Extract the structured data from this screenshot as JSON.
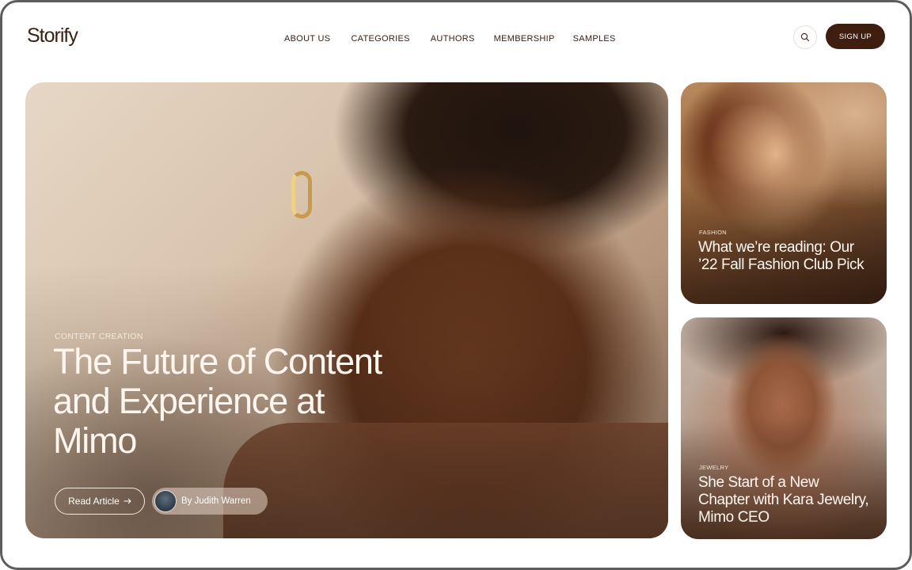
{
  "header": {
    "logo": "Storify",
    "nav": [
      "ABOUT US",
      "CATEGORIES",
      "AUTHORS",
      "MEMBERSHIP",
      "SAMPLES"
    ],
    "search_icon": "search-icon",
    "signup_label": "SIGN UP"
  },
  "hero": {
    "category": "CONTENT CREATION",
    "title": "The Future of Content and Experience at Mimo",
    "read_label": "Read Article",
    "read_icon": "arrow-right-icon",
    "author": "By Judith Warren"
  },
  "side_cards": [
    {
      "category": "FASHION",
      "title": "What we’re reading: Our ’22 Fall Fashion Club Pick"
    },
    {
      "category": "JEWELRY",
      "title": "She Start of a New Chapter with Kara Jewelry, Mimo CEO"
    }
  ],
  "colors": {
    "brand": "#3f1e0f",
    "text": "#3a2114"
  }
}
